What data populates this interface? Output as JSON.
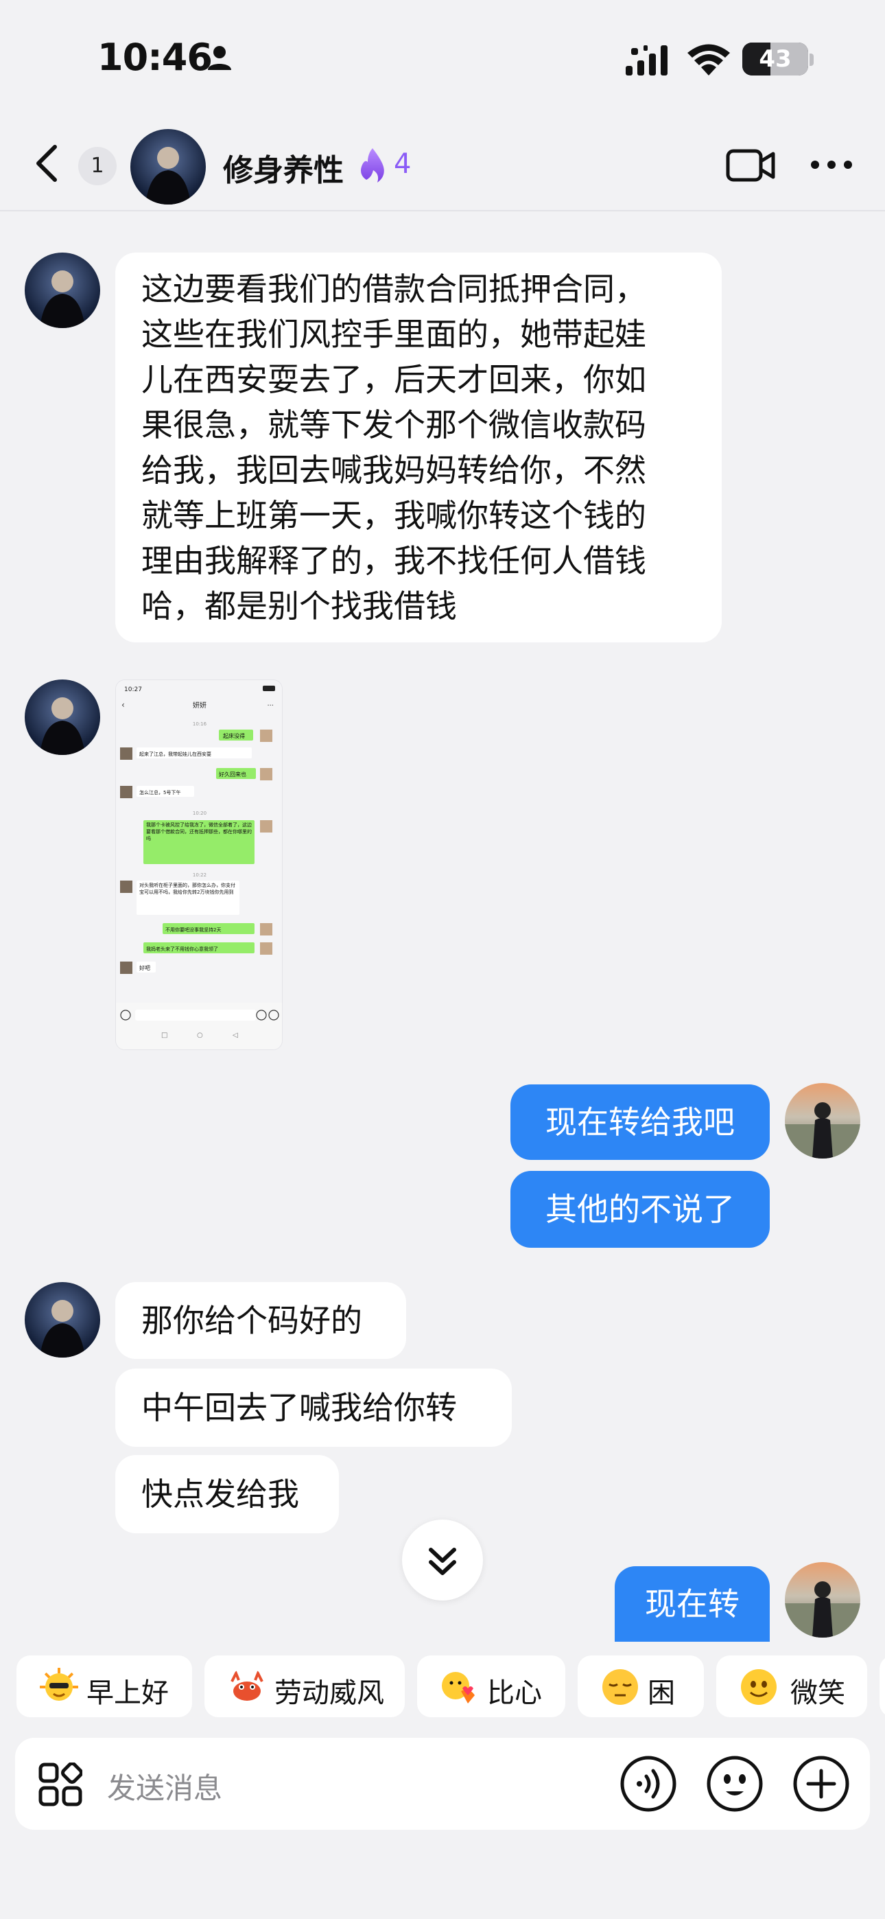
{
  "status_bar": {
    "time": "10:46",
    "battery": "43",
    "battery_level": 0.43
  },
  "header": {
    "unread": "1",
    "title": "修身养性",
    "streak": "4"
  },
  "messages": {
    "m1": [
      "这边要看我们的借款合同抵押合同，",
      "这些在我们风控手里面的，她带起娃",
      "儿在西安耍去了，后天才回来，你如",
      "果很急，就等下发个那个微信收款码",
      "给我，我回去喊我妈妈转给你，不然",
      "就等上班第一天，我喊你转这个钱的",
      "理由我解释了的，我不找任何人借钱",
      "哈，都是别个找我借钱"
    ],
    "m3": "现在转给我吧",
    "m4": "其他的不说了",
    "m5": "那你给个码好的",
    "m6": "中午回去了喊我给你转",
    "m7": "快点发给我",
    "m8": "现在转"
  },
  "screenshot": {
    "time": "10:27",
    "title": "妍妍",
    "t1": "10:16",
    "t2": "10:20",
    "t3": "10:22",
    "msgs": [
      "起床没得",
      "起来了江总，我带起娃儿在西安耍",
      "好久回来也",
      "怎么江总，5号下午",
      "我那个卡被风控了给我冻了，微信全部着了，这边要看那个借款合同，还有抵押那些，都在你哪里的吗",
      "对头我听在柜子里面的，那你怎么办，你支付宝可以用不吗，我给你先转2万块钱你先用到",
      "不用你要吧没事我坚持2天",
      "我妈老头来了不用钱你心意我领了",
      "好吧"
    ]
  },
  "quick_replies": [
    "早上好",
    "劳动威风",
    "比心",
    "困",
    "微笑"
  ],
  "input": {
    "placeholder": "发送消息"
  },
  "colors": {
    "accent_blue": "#2d86f5",
    "streak_purple": "#8b5cf6",
    "wechat_green": "#95ec69"
  },
  "icons": [
    "person-icon",
    "signal-icon",
    "wifi-icon",
    "battery-icon",
    "back-chevron-icon",
    "flame-icon",
    "video-call-icon",
    "more-icon",
    "scroll-down-icon",
    "apps-grid-icon",
    "voice-icon",
    "emoji-icon",
    "plus-icon"
  ]
}
